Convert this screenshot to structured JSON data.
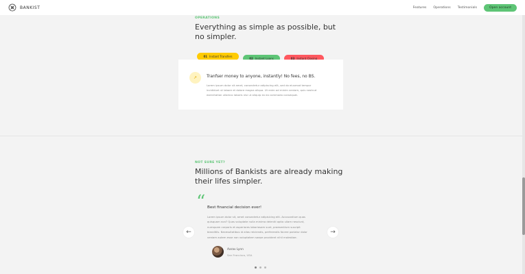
{
  "nav": {
    "brand": "BANKIST",
    "links": [
      "Features",
      "Operations",
      "Testimonials"
    ],
    "cta": "Open account"
  },
  "operations": {
    "eyebrow": "OPERATIONS",
    "headline_line1": "Everything as simple as possible, but",
    "headline_line2": "no simpler.",
    "tabs": [
      {
        "num": "01",
        "label": "Instant Transfers"
      },
      {
        "num": "02",
        "label": "Instant Loans"
      },
      {
        "num": "03",
        "label": "Instant Closing"
      }
    ],
    "active_tab_index": 0,
    "card": {
      "icon_symbol": "↗",
      "title": "Tranfser money to anyone, instantly! No fees, no BS.",
      "text_line1": "Lorem ipsum dolor sit amet, consectetur adipiscing elit, sed do eiusmod tempor",
      "text_line2": "incididunt ut labore et dolore magna aliqua. Ut enim ad minim veniam, quis nostrud",
      "text_line3": "exercitation ullamco laboris nisi ut aliquip ex ea commodo consequat."
    }
  },
  "testimonials": {
    "eyebrow": "NOT SURE YET?",
    "headline_line1": "Millions of Bankists are already making",
    "headline_line2": "their lifes simpler.",
    "quote_mark": "“",
    "title": "Best financial decision ever!",
    "text_line1": "Lorem ipsum dolor sit, amet consectetur adipisicing elit. Accusantium quas",
    "text_line2": "quisquam non? Quas voluptate nulla minima deleniti optio ullam nesciunt,",
    "text_line3": "numquam corporis et asperiores laboriosam sunt, praesentium suscipit",
    "text_line4": "blanditiis. Necessitatibus id alias reiciendis, perferendis facere pariatur dolor",
    "text_line5": "veniam autem esse non voluptatem saepe provident nihil molestiae.",
    "author_name": "Aarav Lynn",
    "author_location": "San Francisco, USA",
    "slider_left_icon": "←",
    "slider_right_icon": "→",
    "dots_count": 3,
    "active_dot": 0
  },
  "colors": {
    "accent_green": "#5ec576",
    "accent_yellow": "#ffcb03",
    "accent_red": "#ff585f",
    "background": "#f3f3f3"
  }
}
